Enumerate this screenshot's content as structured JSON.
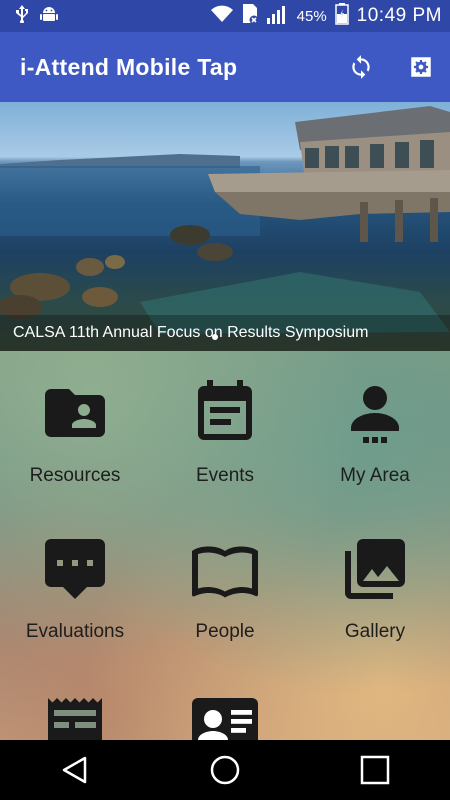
{
  "status_bar": {
    "battery_percent": "45%",
    "time": "10:49 PM",
    "icons": [
      "usb-icon",
      "android-debug-icon",
      "wifi-icon",
      "sim-no-service-icon",
      "signal-icon",
      "battery-icon"
    ]
  },
  "app_bar": {
    "title": "i-Attend Mobile Tap",
    "actions": [
      "refresh-icon",
      "settings-icon"
    ]
  },
  "banner": {
    "caption": "CALSA 11th Annual Focus on Results Symposium",
    "page_indicator": {
      "count": 1,
      "active": 0
    }
  },
  "menu": {
    "tiles": [
      {
        "label": "Resources",
        "icon": "folder-person-icon"
      },
      {
        "label": "Events",
        "icon": "calendar-event-icon"
      },
      {
        "label": "My Area",
        "icon": "person-icon"
      },
      {
        "label": "Evaluations",
        "icon": "chat-bubble-icon"
      },
      {
        "label": "People",
        "icon": "book-icon"
      },
      {
        "label": "Gallery",
        "icon": "photo-library-icon"
      },
      {
        "label": "",
        "icon": "receipt-icon"
      },
      {
        "label": "",
        "icon": "contact-card-icon"
      }
    ]
  },
  "nav_bar": {
    "buttons": [
      "back-icon",
      "home-icon",
      "recents-icon"
    ]
  },
  "colors": {
    "status_bar": "#2f47a6",
    "app_bar": "#3e59c4",
    "icon_fill": "#1a1a1a"
  }
}
